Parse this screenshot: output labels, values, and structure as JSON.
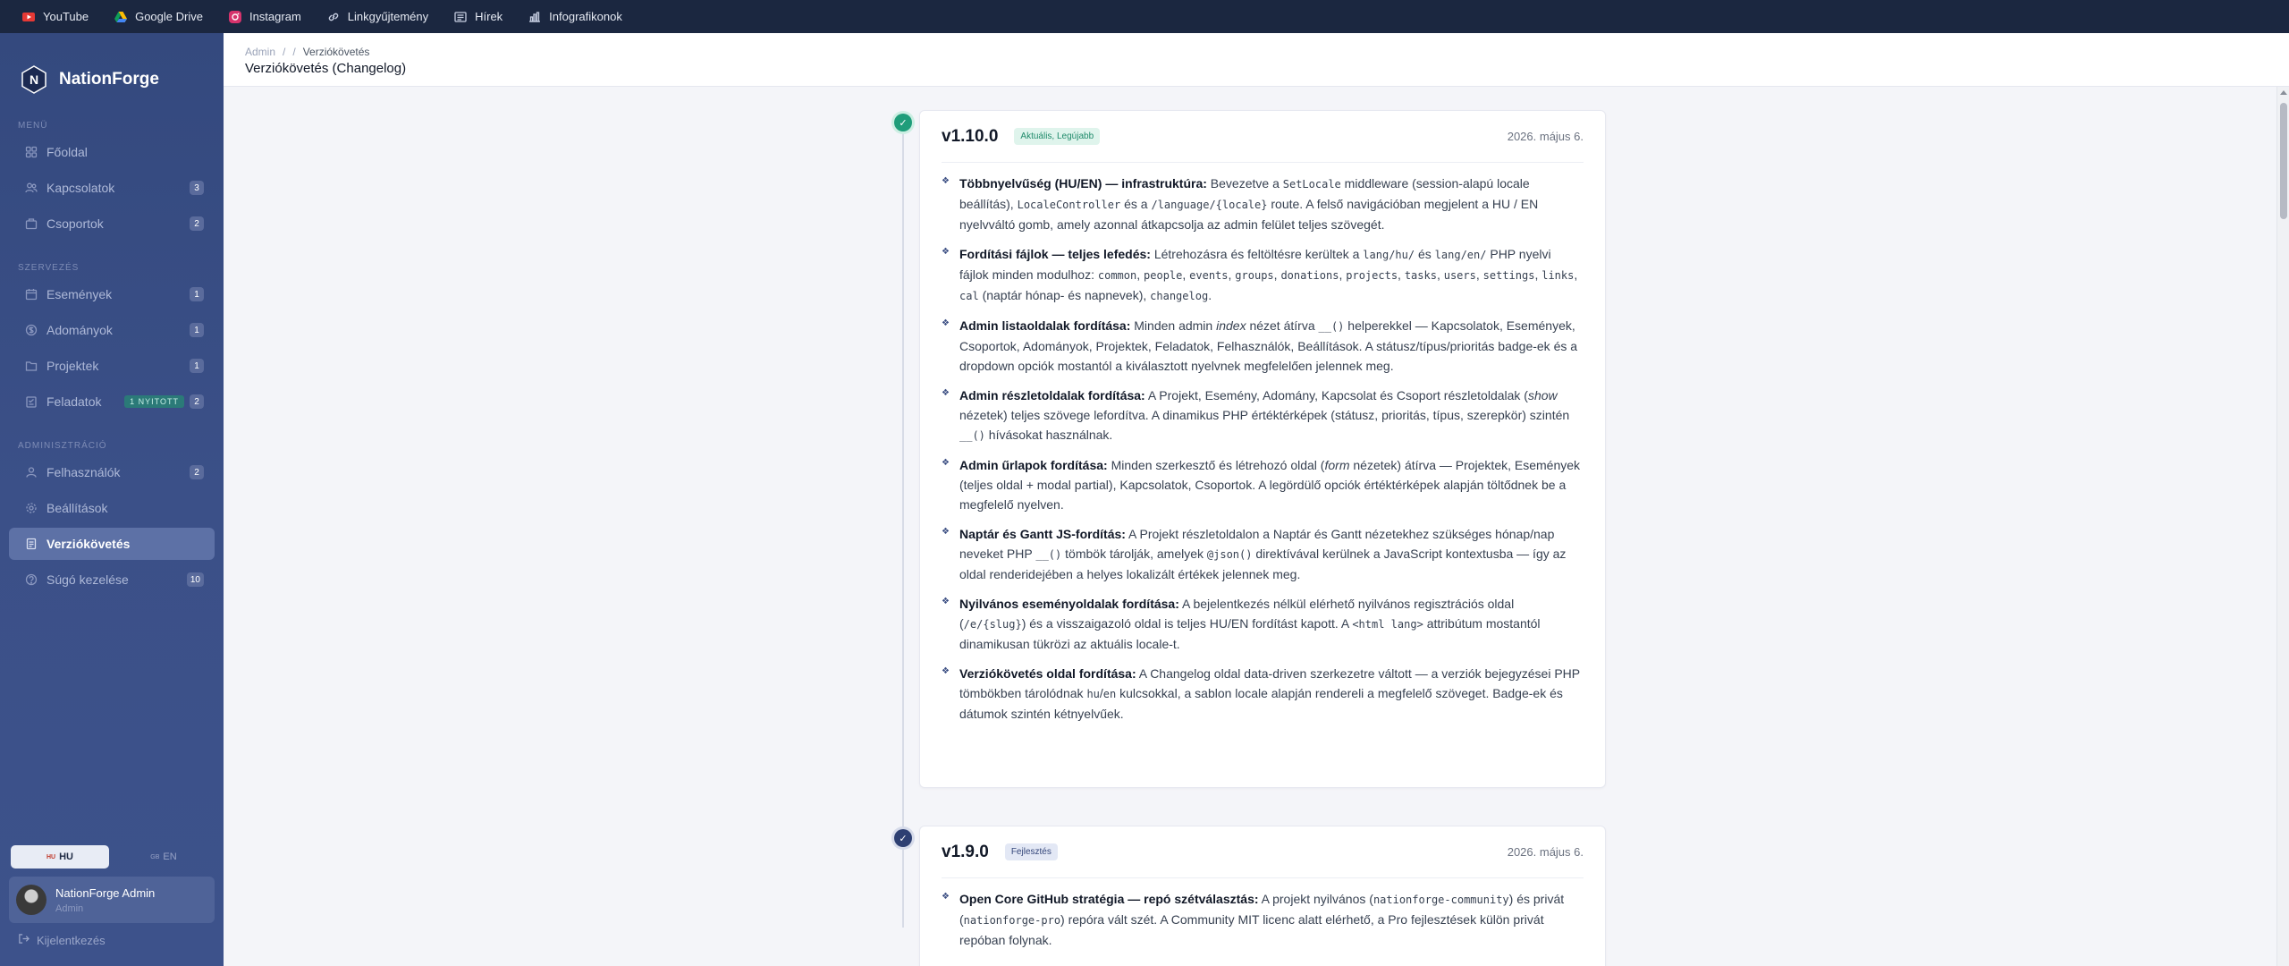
{
  "bookmarks": [
    {
      "label": "YouTube",
      "icon": "youtube-icon"
    },
    {
      "label": "Google Drive",
      "icon": "google-drive-icon"
    },
    {
      "label": "Instagram",
      "icon": "instagram-icon"
    },
    {
      "label": "Linkgyűjtemény",
      "icon": "link-icon"
    },
    {
      "label": "Hírek",
      "icon": "news-icon"
    },
    {
      "label": "Infografikonok",
      "icon": "chart-icon"
    }
  ],
  "brand": {
    "initial": "N",
    "name": "NationForge"
  },
  "sidebar": {
    "section_menu": "MENÜ",
    "section_org": "SZERVEZÉS",
    "section_admin": "ADMINISZTRÁCIÓ",
    "menu": [
      {
        "label": "Főoldal",
        "icon": "home-icon"
      },
      {
        "label": "Kapcsolatok",
        "icon": "users-icon",
        "count": "3"
      },
      {
        "label": "Csoportok",
        "icon": "group-icon",
        "count": "2"
      }
    ],
    "org": [
      {
        "label": "Események",
        "icon": "calendar-icon",
        "count": "1"
      },
      {
        "label": "Adományok",
        "icon": "donation-icon",
        "count": "1"
      },
      {
        "label": "Projektek",
        "icon": "folder-icon",
        "count": "1"
      },
      {
        "label": "Feladatok",
        "icon": "task-icon",
        "badge": "1 NYITOTT",
        "count": "2"
      }
    ],
    "admin": [
      {
        "label": "Felhasználók",
        "icon": "user-icon",
        "count": "2"
      },
      {
        "label": "Beállítások",
        "icon": "gear-icon"
      },
      {
        "label": "Verziókövetés",
        "icon": "history-icon",
        "active": true
      },
      {
        "label": "Súgó kezelése",
        "icon": "help-icon",
        "count": "10"
      }
    ],
    "lang_hu": "HU",
    "lang_hu_flag": "HU",
    "lang_en": "EN",
    "lang_en_flag": "GB",
    "user_name": "NationForge Admin",
    "user_role": "Admin",
    "logout": "Kijelentkezés"
  },
  "header": {
    "crumb_root": "Admin",
    "crumb_sep": "/",
    "crumb_current": "Verziókövetés",
    "title": "Verziókövetés (Changelog)"
  },
  "release1": {
    "version": "v1.10.0",
    "badge": "Aktuális, Legújabb",
    "date": "2026. május 6."
  },
  "release2": {
    "version": "v1.9.0",
    "badge": "Fejlesztés",
    "date": "2026. május 6."
  },
  "colors": {
    "sidebar_bg": "#3b5088",
    "topbar_bg": "#1b2740",
    "accent_green": "#1f9d7a",
    "accent_blue": "#2d3f72"
  }
}
